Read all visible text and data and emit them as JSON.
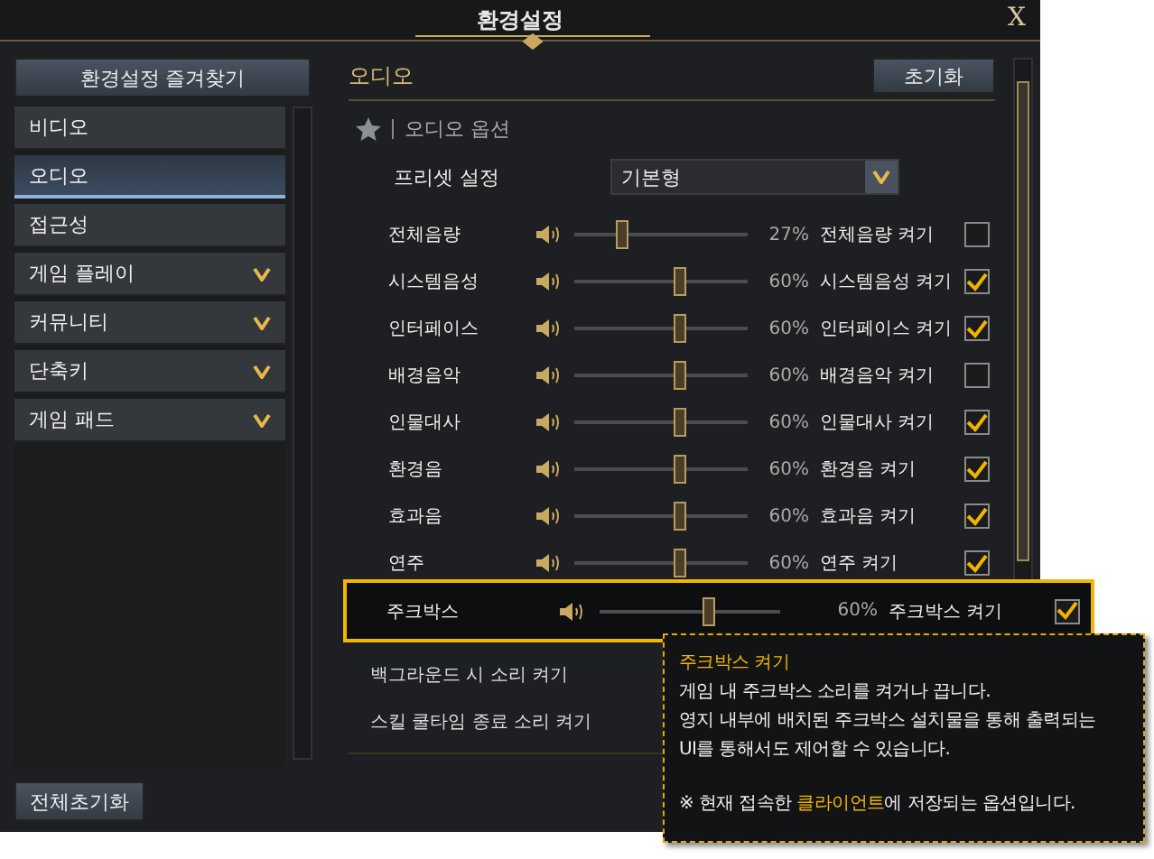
{
  "window": {
    "title": "환경설정",
    "close": "X"
  },
  "sidebar": {
    "favorites_button": "환경설정 즐겨찾기",
    "items": [
      {
        "label": "비디오",
        "selected": false,
        "expandable": false
      },
      {
        "label": "오디오",
        "selected": true,
        "expandable": false
      },
      {
        "label": "접근성",
        "selected": false,
        "expandable": false
      },
      {
        "label": "게임 플레이",
        "selected": false,
        "expandable": true
      },
      {
        "label": "커뮤니티",
        "selected": false,
        "expandable": true
      },
      {
        "label": "단축키",
        "selected": false,
        "expandable": true
      },
      {
        "label": "게임 패드",
        "selected": false,
        "expandable": true
      }
    ],
    "reset_all_button": "전체초기화"
  },
  "content": {
    "title": "오디오",
    "reset_button": "초기화",
    "section": "오디오 옵션",
    "preset": {
      "label": "프리셋 설정",
      "value": "기본형"
    },
    "channels": [
      {
        "name": "전체음량",
        "level": 0.27,
        "reading": "27%",
        "toggle_label": "전체음량 켜기",
        "checked": false
      },
      {
        "name": "시스템음성",
        "level": 0.6,
        "reading": "60%",
        "toggle_label": "시스템음성 켜기",
        "checked": true
      },
      {
        "name": "인터페이스",
        "level": 0.6,
        "reading": "60%",
        "toggle_label": "인터페이스 켜기",
        "checked": true
      },
      {
        "name": "배경음악",
        "level": 0.6,
        "reading": "60%",
        "toggle_label": "배경음악 켜기",
        "checked": false
      },
      {
        "name": "인물대사",
        "level": 0.6,
        "reading": "60%",
        "toggle_label": "인물대사 켜기",
        "checked": true
      },
      {
        "name": "환경음",
        "level": 0.6,
        "reading": "60%",
        "toggle_label": "환경음 켜기",
        "checked": true
      },
      {
        "name": "효과음",
        "level": 0.6,
        "reading": "60%",
        "toggle_label": "효과음 켜기",
        "checked": true
      },
      {
        "name": "연주",
        "level": 0.6,
        "reading": "60%",
        "toggle_label": "연주 켜기",
        "checked": true
      }
    ],
    "highlighted_channel": {
      "name": "주크박스",
      "level": 0.6,
      "reading": "60%",
      "toggle_label": "주크박스 켜기",
      "checked": true
    },
    "extra_options": [
      "백그라운드 시 소리 켜기",
      "스킬 쿨타임 종료 소리 켜기"
    ],
    "tooltip": {
      "title": "주크박스 켜기",
      "lines": [
        "게임 내 주크박스 소리를 켜거나 끕니다.",
        "영지 내부에 배치된 주크박스 설치물을 통해 출력되는",
        "UI를 통해서도 제어할 수 있습니다."
      ],
      "note": "※ 현재 접속한 **클라이언트**에 저장되는 옵션입니다."
    }
  }
}
